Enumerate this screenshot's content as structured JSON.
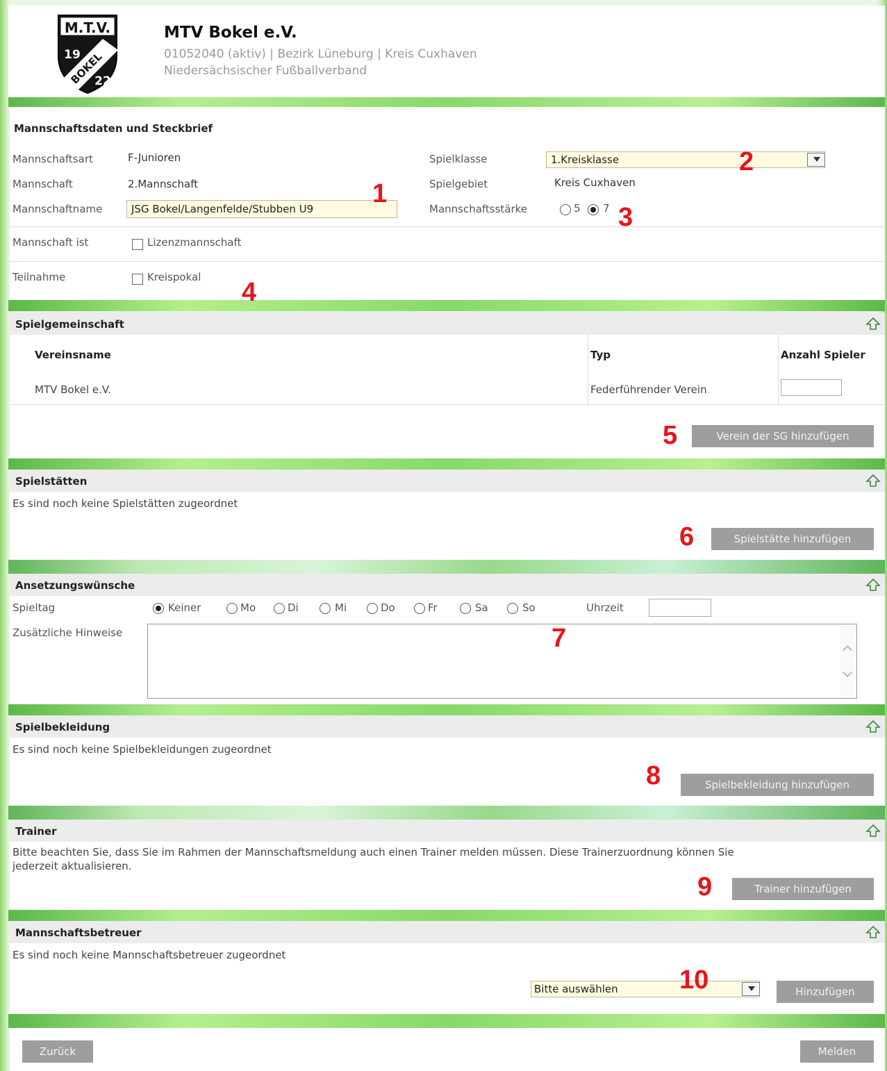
{
  "club": {
    "logo_text_top": "M.T.V.",
    "logo_text_year_left": "19",
    "logo_text_name": "BOKEL",
    "logo_text_year_right": "22",
    "name": "MTV Bokel e.V.",
    "info_line": "01052040 (aktiv) | Bezirk Lüneburg | Kreis Cuxhaven",
    "association": "Niedersächsischer Fußballverband"
  },
  "team_data": {
    "title": "Mannschaftsdaten und Steckbrief",
    "art_label": "Mannschaftsart",
    "art_value": "F-Junioren",
    "team_label": "Mannschaft",
    "team_value": "2.Mannschaft",
    "name_label": "Mannschaftname",
    "name_value": "JSG Bokel/Langenfelde/Stubben U9",
    "class_label": "Spielklasse",
    "class_value": "1.Kreisklasse",
    "area_label": "Spielgebiet",
    "area_value": "Kreis Cuxhaven",
    "strength_label": "Mannschaftsstärke",
    "strength_options": [
      "5",
      "7"
    ],
    "strength_selected": "7",
    "is_label": "Mannschaft ist",
    "license_label": "Lizenzmannschaft",
    "participation_label": "Teilnahme",
    "cup_label": "Kreispokal"
  },
  "sg": {
    "title": "Spielgemeinschaft",
    "col_name": "Vereinsname",
    "col_type": "Typ",
    "col_players": "Anzahl Spieler",
    "rows": [
      {
        "name": "MTV Bokel e.V.",
        "type": "Federführender Verein",
        "players": ""
      }
    ],
    "add_button": "Verein der SG hinzufügen"
  },
  "venues": {
    "title": "Spielstätten",
    "empty_text": "Es sind noch keine Spielstätten zugeordnet",
    "add_button": "Spielstätte hinzufügen"
  },
  "scheduling": {
    "title": "Ansetzungswünsche",
    "day_label": "Spieltag",
    "days": [
      "Keiner",
      "Mo",
      "Di",
      "Mi",
      "Do",
      "Fr",
      "Sa",
      "So"
    ],
    "selected_day": "Keiner",
    "time_label": "Uhrzeit",
    "time_value": "",
    "notes_label": "Zusätzliche Hinweise",
    "notes_value": ""
  },
  "kit": {
    "title": "Spielbekleidung",
    "empty_text": "Es sind noch keine Spielbekleidungen zugeordnet",
    "add_button": "Spielbekleidung hinzufügen"
  },
  "trainer": {
    "title": "Trainer",
    "note_line1": "Bitte beachten Sie, dass Sie im Rahmen der Mannschaftsmeldung auch einen Trainer melden müssen. Diese Trainerzuordnung können Sie",
    "note_line2": "jederzeit aktualisieren.",
    "add_button": "Trainer hinzufügen"
  },
  "managers": {
    "title": "Mannschaftsbetreuer",
    "empty_text": "Es sind noch keine Mannschaftsbetreuer zugeordnet",
    "select_value": "Bitte auswählen",
    "add_button": "Hinzufügen"
  },
  "footer": {
    "back_button": "Zurück",
    "submit_button": "Melden"
  },
  "markers": [
    "1",
    "2",
    "3",
    "4",
    "5",
    "6",
    "7",
    "8",
    "9",
    "10"
  ],
  "colors": {
    "accent_green": "#8ed36d",
    "marker_red": "#e8141b",
    "button_gray": "#9e9e9e",
    "input_yellow": "#fffbe0"
  }
}
